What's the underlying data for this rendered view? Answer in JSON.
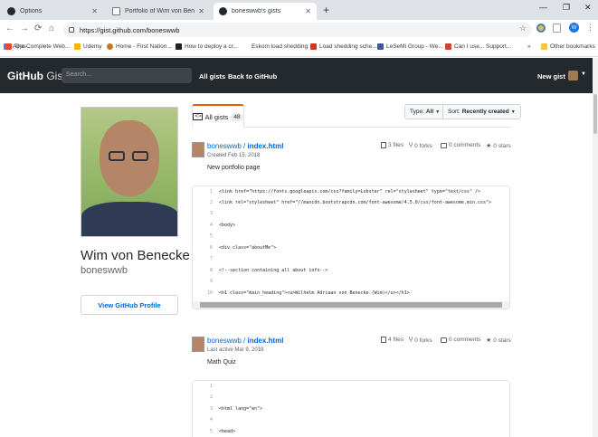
{
  "browser": {
    "tabs": [
      {
        "label": "Options",
        "icon": "github-icon",
        "active": false
      },
      {
        "label": "Portfolio of Wim von Benecke",
        "icon": "page-icon",
        "active": false
      },
      {
        "label": "boneswwb's gists",
        "icon": "github-icon",
        "active": true
      }
    ],
    "url": "https://gist.github.com/boneswwb",
    "bookmarks": [
      {
        "label": "Apps",
        "color": "#4285f4"
      },
      {
        "label": "The Complete Web...",
        "color": "#e34b2a"
      },
      {
        "label": "Udemy",
        "color": "#f4b400"
      },
      {
        "label": "Home - First Nation...",
        "color": "#c07a1f"
      },
      {
        "label": "How to deploy a cr...",
        "color": "#222222"
      },
      {
        "label": "Eskom load shedding",
        "color": "#ffffff"
      },
      {
        "label": "Load shedding sche...",
        "color": "#d93025"
      },
      {
        "label": "LeSeMi Group - We...",
        "color": "#3b5998"
      },
      {
        "label": "Can I use... Support...",
        "color": "#c7492b"
      },
      {
        "label": "Other bookmarks",
        "color": "#f4c542"
      }
    ],
    "more_label": "»",
    "profile_initial": "W"
  },
  "gist_header": {
    "logo_bold": "GitHub",
    "logo_light": "Gist",
    "search_placeholder": "Search...",
    "all_gists": "All gists",
    "back": "Back to GitHub",
    "new_gist": "New gist"
  },
  "profile": {
    "name": "Wim von Benecke",
    "username": "boneswwb",
    "view_profile": "View GitHub Profile"
  },
  "gist_tabs": {
    "all_label": "All gists",
    "all_count": "48",
    "type_label": "Type:",
    "type_value": "All",
    "sort_label": "Sort:",
    "sort_value": "Recently created"
  },
  "gists": [
    {
      "owner": "boneswwb",
      "file": "index.html",
      "date": "Created Feb 15, 2018",
      "description": "New portfolio page",
      "files": "3 files",
      "forks": "0 forks",
      "comments": "0 comments",
      "stars": "0 stars",
      "lines": [
        {
          "n": "1",
          "text": "<link href=\"https://fonts.googleapis.com/css?family=Lobster\" rel=\"stylesheet\" type=\"text/css\" />"
        },
        {
          "n": "2",
          "text": "<link rel=\"stylesheet\" href=\"//maxcdn.bootstrapcdn.com/font-awesome/4.5.0/css/font-awesome.min.css\">"
        },
        {
          "n": "3",
          "text": ""
        },
        {
          "n": "4",
          "text": "<body>"
        },
        {
          "n": "5",
          "text": ""
        },
        {
          "n": "6",
          "text": "    <div class=\"aboutMe\">"
        },
        {
          "n": "7",
          "text": ""
        },
        {
          "n": "8",
          "text": "        <!--section containing all about info-->"
        },
        {
          "n": "9",
          "text": ""
        },
        {
          "n": "10",
          "text": "        <h1 class=\"main_heading\"><u>Wilhelm Adriaan von Benecke.(Wim)</u></h1>"
        }
      ]
    },
    {
      "owner": "boneswwb",
      "file": "index.html",
      "date": "Last active Mar 9, 2018",
      "description": "Math Quiz",
      "files": "4 files",
      "forks": "0 forks",
      "comments": "0 comments",
      "stars": "0 stars",
      "lines": [
        {
          "n": "1",
          "text": ""
        },
        {
          "n": "2",
          "text": ""
        },
        {
          "n": "3",
          "text": "<html lang=\"en\">"
        },
        {
          "n": "4",
          "text": ""
        },
        {
          "n": "5",
          "text": "<head>"
        }
      ]
    }
  ]
}
